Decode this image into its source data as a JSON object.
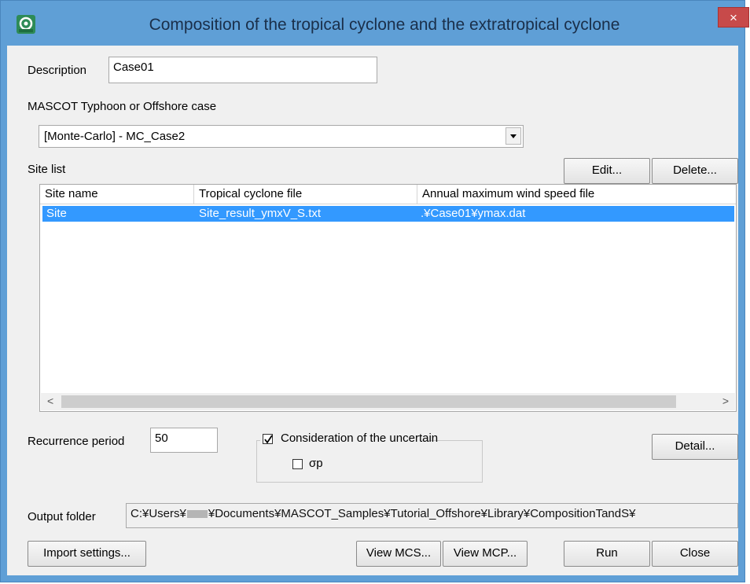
{
  "window": {
    "title": "Composition of the tropical cyclone and the extratropical cyclone",
    "close_glyph": "×"
  },
  "description": {
    "label": "Description",
    "value": "Case01"
  },
  "mascot_case": {
    "label": "MASCOT Typhoon or Offshore case",
    "selected": "[Monte-Carlo] - MC_Case2"
  },
  "site_list": {
    "label": "Site list",
    "edit_label": "Edit...",
    "delete_label": "Delete...",
    "columns": [
      "Site name",
      "Tropical cyclone file",
      "Annual maximum wind speed file"
    ],
    "rows": [
      {
        "site_name": "Site",
        "tropical_file": "Site_result_ymxV_S.txt",
        "annual_file": ".¥Case01¥ymax.dat",
        "selected": true
      }
    ],
    "scroll_left": "<",
    "scroll_right": ">"
  },
  "recurrence": {
    "label": "Recurrence period",
    "value": "50"
  },
  "uncertainty": {
    "label": "Consideration of the uncertain",
    "checked": true,
    "sigma_label": "σp",
    "sigma_checked": false
  },
  "detail_label": "Detail...",
  "output_folder": {
    "label": "Output folder",
    "value_prefix": "C:¥Users¥",
    "value_suffix": "¥Documents¥MASCOT_Samples¥Tutorial_Offshore¥Library¥CompositionTandS¥"
  },
  "buttons": {
    "import_settings": "Import settings...",
    "view_mcs": "View MCS...",
    "view_mcp": "View MCP...",
    "run": "Run",
    "close": "Close"
  },
  "colors": {
    "titlebar": "#5f9fd6",
    "selection": "#3399ff",
    "close_button": "#c74a4a"
  }
}
